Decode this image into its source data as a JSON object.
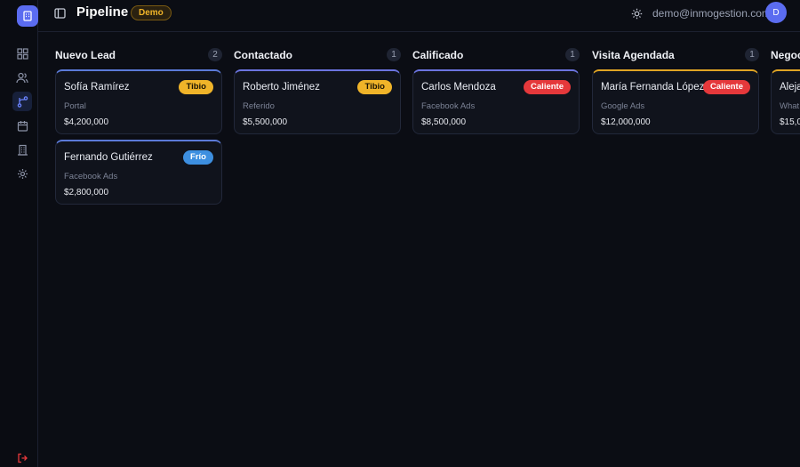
{
  "header": {
    "title": "Pipeline",
    "badge": "Demo",
    "email": "demo@inmogestion.com",
    "avatar_initial": "D"
  },
  "sidebar": {
    "items": [
      {
        "icon": "dashboard-icon"
      },
      {
        "icon": "users-icon"
      },
      {
        "icon": "pipeline-icon",
        "active": true
      },
      {
        "icon": "calendar-icon"
      },
      {
        "icon": "buildings-icon"
      },
      {
        "icon": "gear-icon"
      }
    ],
    "logout_icon": "logout-icon"
  },
  "colors": {
    "accent": "#5b6cf0",
    "tibio": "#f0b429",
    "caliente": "#e5383b",
    "frio": "#3d8fe0"
  },
  "columns": [
    {
      "title": "Nuevo Lead",
      "count": "2",
      "cards": [
        {
          "name": "Sofía Ramírez",
          "badge": "Tibio",
          "source": "Portal",
          "amount": "$4,200,000"
        },
        {
          "name": "Fernando Gutiérrez",
          "badge": "Frío",
          "source": "Facebook Ads",
          "amount": "$2,800,000"
        }
      ]
    },
    {
      "title": "Contactado",
      "count": "1",
      "cards": [
        {
          "name": "Roberto Jiménez",
          "badge": "Tibio",
          "source": "Referido",
          "amount": "$5,500,000"
        }
      ]
    },
    {
      "title": "Calificado",
      "count": "1",
      "cards": [
        {
          "name": "Carlos Mendoza",
          "badge": "Caliente",
          "source": "Facebook Ads",
          "amount": "$8,500,000"
        }
      ]
    },
    {
      "title": "Visita Agendada",
      "count": "1",
      "cards": [
        {
          "name": "María Fernanda López",
          "badge": "Caliente",
          "source": "Google Ads",
          "amount": "$12,000,000"
        }
      ]
    },
    {
      "title": "Negoc",
      "count": "",
      "cards": [
        {
          "name": "Aleja",
          "badge": "",
          "source": "What",
          "amount": "$15,0"
        }
      ]
    }
  ]
}
